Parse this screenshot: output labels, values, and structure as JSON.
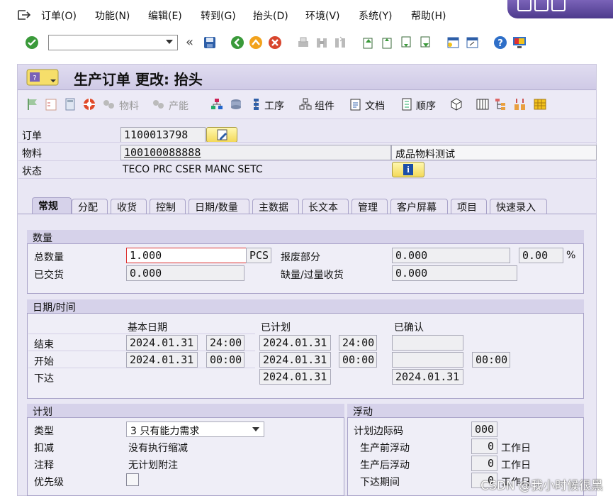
{
  "menu": {
    "items": [
      "订单(O)",
      "功能(N)",
      "编辑(E)",
      "转到(G)",
      "抬头(D)",
      "环境(V)",
      "系统(Y)",
      "帮助(H)"
    ]
  },
  "toolbar": {
    "command_value": ""
  },
  "screen": {
    "title": "生产订单 更改: 抬头"
  },
  "app_toolbar": {
    "material": "物料",
    "capacity": "产能",
    "operations": "工序",
    "components": "组件",
    "documents": "文档",
    "sequences": "顺序"
  },
  "header": {
    "order_label": "订单",
    "order_value": "1100013798",
    "material_label": "物料",
    "material_value": "100100088888",
    "material_desc": "成品物料测试",
    "status_label": "状态",
    "status_value": "TECO PRC  CSER MANC SETC"
  },
  "tabs": [
    "常规",
    "分配",
    "收货",
    "控制",
    "日期/数量",
    "主数据",
    "长文本",
    "管理",
    "客户屏幕",
    "项目",
    "快速录入"
  ],
  "quantity": {
    "title": "数量",
    "total_label": "总数量",
    "total_value": "1.000",
    "unit": "PCS",
    "scrap_label": "报废部分",
    "scrap_value": "0.000",
    "scrap_pct": "0.00",
    "pct_sign": "%",
    "delivered_label": "已交货",
    "delivered_value": "0.000",
    "short_label": "缺量/过量收货",
    "short_value": "0.000"
  },
  "dates": {
    "title": "日期/时间",
    "col_basic": "基本日期",
    "col_sched": "已计划",
    "col_conf": "已确认",
    "end_label": "结束",
    "start_label": "开始",
    "release_label": "下达",
    "end_basic_date": "2024.01.31",
    "end_basic_time": "24:00",
    "end_sched_date": "2024.01.31",
    "end_sched_time": "24:00",
    "end_conf_date": "",
    "start_basic_date": "2024.01.31",
    "start_basic_time": "00:00",
    "start_sched_date": "2024.01.31",
    "start_sched_time": "00:00",
    "start_conf_date": "",
    "start_conf_time": "00:00",
    "release_sched_date": "2024.01.31",
    "release_conf_date": "2024.01.31"
  },
  "planning": {
    "title": "计划",
    "type_label": "类型",
    "type_value": "3 只有能力需求",
    "reduction_label": "扣减",
    "reduction_value": "没有执行缩减",
    "note_label": "注释",
    "note_value": "无计划附注",
    "priority_label": "优先级"
  },
  "float": {
    "title": "浮动",
    "sm_key_label": "计划边际码",
    "sm_key_value": "000",
    "before_label": "生产前浮动",
    "before_value": "0",
    "before_unit": "工作日",
    "after_label": "生产后浮动",
    "after_value": "0",
    "after_unit": "工作日",
    "release_label": "下达期间",
    "release_value": "0",
    "release_unit": "工作日"
  },
  "watermark": "CSDN @我小时候很黑"
}
